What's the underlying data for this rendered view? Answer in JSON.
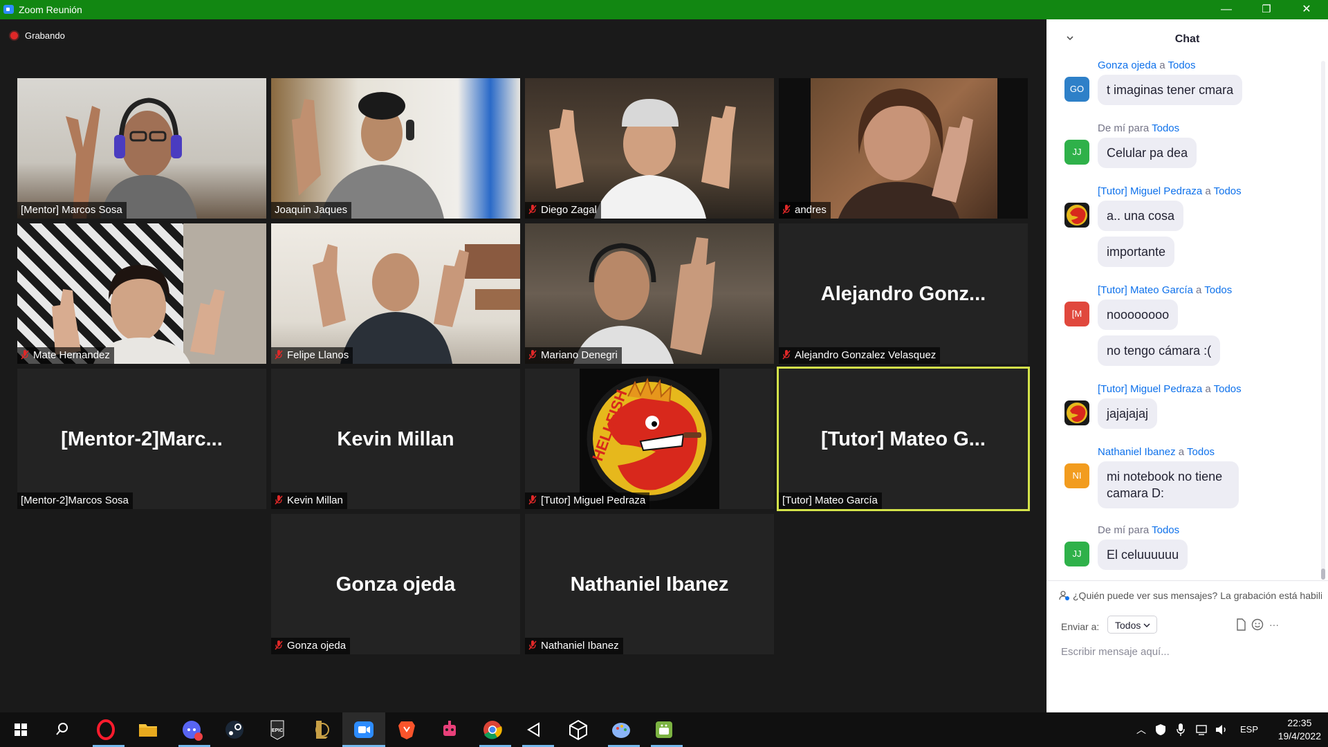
{
  "window": {
    "title": "Zoom Reunión",
    "minimize": "—",
    "restore": "❐",
    "close": "✕"
  },
  "meeting": {
    "recording_label": "Grabando",
    "tiles": [
      {
        "name": "[Mentor] Marcos Sosa",
        "muted": false,
        "video": true
      },
      {
        "name": "Joaquin Jaques",
        "muted": false,
        "video": true
      },
      {
        "name": "Diego Zagal",
        "muted": true,
        "video": true
      },
      {
        "name": "andres",
        "muted": true,
        "video": true
      },
      {
        "name": "Mate Hernandez",
        "muted": true,
        "video": true
      },
      {
        "name": "Felipe Llanos",
        "muted": true,
        "video": true
      },
      {
        "name": "Mariano Denegri",
        "muted": true,
        "video": true
      },
      {
        "name": "Alejandro Gonzalez Velasquez",
        "display": "Alejandro  Gonz...",
        "muted": true,
        "video": false
      },
      {
        "name": "[Mentor-2]Marcos Sosa",
        "display": "[Mentor-2]Marc...",
        "muted": false,
        "video": false
      },
      {
        "name": "Kevin Millan",
        "display": "Kevin Millan",
        "muted": true,
        "video": false
      },
      {
        "name": "[Tutor] Miguel Pedraza",
        "muted": true,
        "video": true,
        "logo_text": "HELLFISH"
      },
      {
        "name": "[Tutor] Mateo García",
        "display": "[Tutor]  Mateo G...",
        "muted": false,
        "video": false,
        "active_speaker": true
      },
      {
        "name": "Gonza ojeda",
        "display": "Gonza ojeda",
        "muted": true,
        "video": false
      },
      {
        "name": "Nathaniel Ibanez",
        "display": "Nathaniel Ibanez",
        "muted": true,
        "video": false
      }
    ]
  },
  "chat": {
    "title": "Chat",
    "messages": [
      {
        "sender": "Gonza ojeda",
        "connector": "a",
        "to": "Todos",
        "avatar": "GO",
        "avatar_color": "#2e80c8",
        "texts": [
          "t imaginas tener cmara"
        ]
      },
      {
        "sender": "Yo",
        "header_prefix": "De mí para",
        "to": "Todos",
        "avatar": "JJ",
        "avatar_color": "#2fb14a",
        "texts": [
          "Celular pa dea"
        ]
      },
      {
        "sender": "[Tutor] Miguel Pedraza",
        "connector": "a",
        "to": "Todos",
        "avatar": "",
        "avatar_color": "#1a1a1a",
        "texts": [
          "a.. una cosa",
          "importante"
        ]
      },
      {
        "sender": "[Tutor] Mateo García",
        "connector": "a",
        "to": "Todos",
        "avatar": "[M",
        "avatar_color": "#e0483d",
        "texts": [
          "noooooooo",
          "no tengo cámara :("
        ]
      },
      {
        "sender": "[Tutor] Miguel Pedraza",
        "connector": "a",
        "to": "Todos",
        "avatar": "",
        "avatar_color": "#1a1a1a",
        "texts": [
          "jajajajaj"
        ]
      },
      {
        "sender": "Nathaniel Ibanez",
        "connector": "a",
        "to": "Todos",
        "avatar": "NI",
        "avatar_color": "#f29c1f",
        "texts": [
          "mi notebook no tiene camara D:"
        ]
      },
      {
        "sender": "Yo",
        "header_prefix": "De mí para",
        "to": "Todos",
        "avatar": "JJ",
        "avatar_color": "#2fb14a",
        "texts": [
          "El celuuuuuu"
        ]
      }
    ],
    "notice": "¿Quién puede ver sus mensajes? La grabación está habilitada.",
    "send_to_label": "Enviar a:",
    "send_to_value": "Todos",
    "input_placeholder": "Escribir mensaje aquí..."
  },
  "taskbar": {
    "apps": [
      "start",
      "search",
      "opera",
      "file-explorer",
      "discord",
      "steam",
      "epic-games",
      "league-of-legends",
      "zoom",
      "brave",
      "robot-app",
      "chrome",
      "unity-hub",
      "unity",
      "paint-app",
      "android-app"
    ],
    "language": "ESP",
    "time": "22:35",
    "date": "19/4/2022"
  }
}
